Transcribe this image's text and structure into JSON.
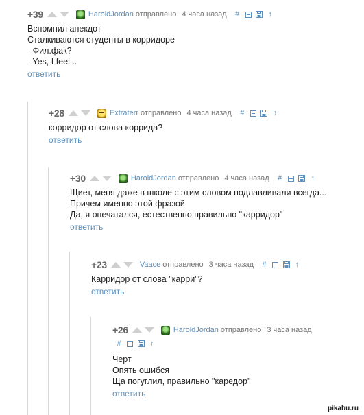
{
  "colors": {
    "link": "#5b8fbd",
    "meta": "#777777",
    "score": "#666666",
    "vote": "#cfcfcf",
    "thread_line": "#d8d8d8"
  },
  "comments": [
    {
      "score": "+39",
      "user": "HaroldJordan",
      "avatar_icon": "green-avatar-icon",
      "sent": "отправлено",
      "time": "4 часа назад",
      "actions": {
        "hash": "#",
        "collapse": "⊟",
        "save": "save-icon",
        "parent": "↑"
      },
      "lines": [
        "Вспомнил анекдот",
        "Сталкиваются студенты в корридоре",
        "- Фил.фак?",
        "- Yes, I feel..."
      ],
      "reply": "ответить"
    },
    {
      "score": "+28",
      "user": "Extraterr",
      "avatar_icon": "yellow-avatar-icon",
      "sent": "отправлено",
      "time": "4 часа назад",
      "actions": {
        "hash": "#",
        "collapse": "⊟",
        "save": "save-icon",
        "parent": "↑"
      },
      "lines": [
        "корридор от слова коррида?"
      ],
      "reply": "ответить"
    },
    {
      "score": "+30",
      "user": "HaroldJordan",
      "avatar_icon": "green-avatar-icon",
      "sent": "отправлено",
      "time": "4 часа назад",
      "actions": {
        "hash": "#",
        "collapse": "⊟",
        "save": "save-icon",
        "parent": "↑"
      },
      "lines": [
        "Щиет, меня даже в школе с этим словом подлавливали всегда...",
        "Причем именно этой фразой",
        "Да, я опечатался, естественно правильно \"карридор\""
      ],
      "reply": "ответить"
    },
    {
      "score": "+23",
      "user": "Vaace",
      "avatar_icon": "none",
      "sent": "отправлено",
      "time": "3 часа назад",
      "actions": {
        "hash": "#",
        "collapse": "⊟",
        "save": "save-icon",
        "parent": "↑"
      },
      "lines": [
        "Карридор от слова \"карри\"?"
      ],
      "reply": "ответить"
    },
    {
      "score": "+26",
      "user": "HaroldJordan",
      "avatar_icon": "green-avatar-icon",
      "sent": "отправлено",
      "time": "3 часа назад",
      "actions": {
        "hash": "#",
        "collapse": "⊟",
        "save": "save-icon",
        "parent": "↑"
      },
      "lines": [
        "Черт",
        "Опять ошибся",
        "Ща погуглил, правильно \"каредор\""
      ],
      "reply": "ответить"
    }
  ],
  "watermark": "pikabu.ru"
}
